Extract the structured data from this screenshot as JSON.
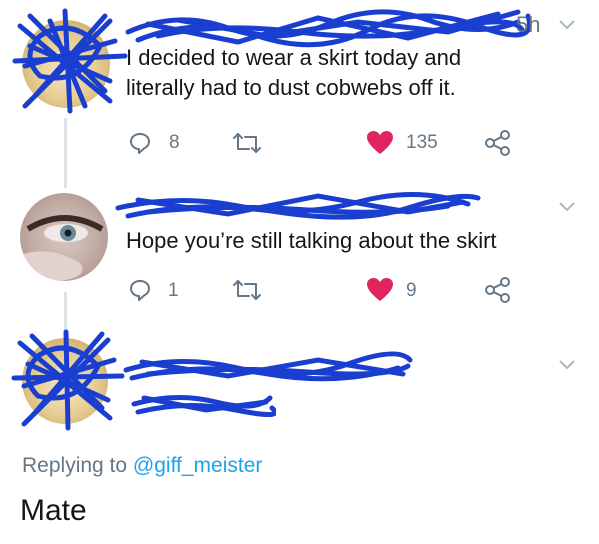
{
  "tweets": [
    {
      "time": "5h",
      "text": "I decided to wear a skirt today and literally had to dust cobwebs off it.",
      "reply_count": "8",
      "like_count": "135"
    },
    {
      "text": "Hope you’re still talking about the skirt",
      "reply_count": "1",
      "like_count": "9"
    },
    {
      "replying_prefix": "Replying to ",
      "replying_handle": "@giff_meister",
      "text": "Mate"
    }
  ],
  "colors": {
    "like_red": "#e0245e",
    "muted_gray": "#657786",
    "link_blue": "#1da1f2",
    "redaction_blue": "#1a3fd0"
  },
  "icons": [
    "reply-icon",
    "retweet-icon",
    "heart-icon",
    "share-icon",
    "chevron-down-icon"
  ]
}
